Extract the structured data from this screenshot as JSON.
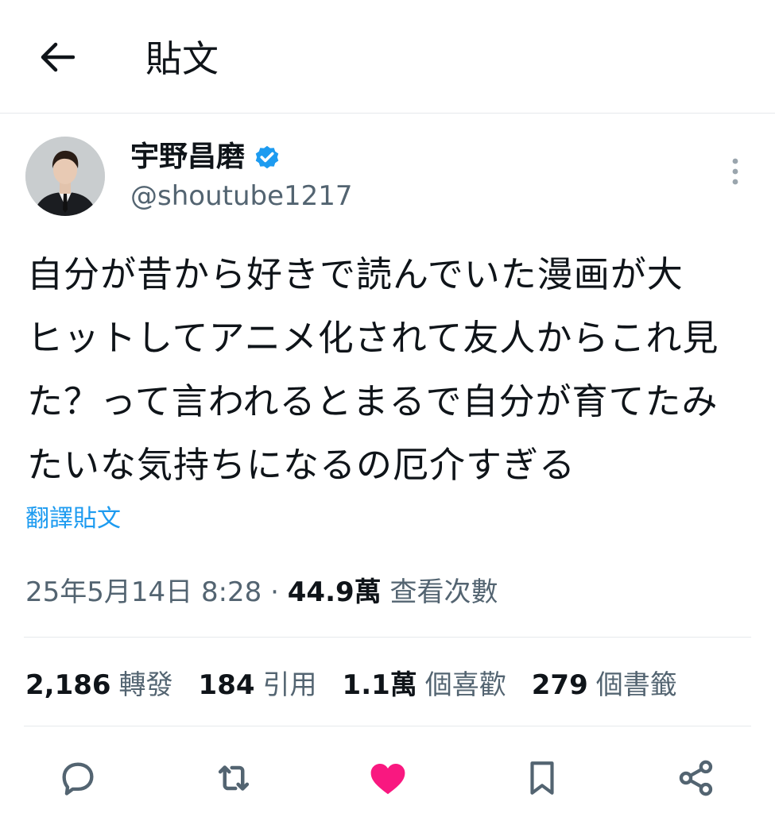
{
  "header": {
    "back_icon": "arrow-left-icon",
    "title": "貼文"
  },
  "author": {
    "display_name": "宇野昌磨",
    "handle": "@shoutube1217",
    "verified_icon": "verified-badge-icon",
    "verified_color": "#1d9bf0"
  },
  "tweet": {
    "lines": [
      "自分が昔から好きで読んでいた漫画が大",
      "ヒットしてアニメ化されて友人からこれ見",
      "た？って言われるとまるで自分が育てたみ",
      "たいな気持ちになるの厄介すぎる"
    ],
    "translate_label": "翻譯貼文",
    "timestamp": "25年5月14日 8:28",
    "separator": "·",
    "views_count": "44.9萬",
    "views_label": "查看次數"
  },
  "stats": {
    "reposts_count": "2,186",
    "reposts_label": "轉發",
    "quotes_count": "184",
    "quotes_label": "引用",
    "likes_count": "1.1萬",
    "likes_label": "個喜歡",
    "bookmarks_count": "279",
    "bookmarks_label": "個書籤"
  },
  "actions": {
    "reply_icon": "reply-icon",
    "repost_icon": "repost-icon",
    "like_icon": "heart-icon",
    "like_color": "#f91880",
    "bookmark_icon": "bookmark-icon",
    "share_icon": "share-icon"
  },
  "colors": {
    "accent": "#1d9bf0",
    "secondary_text": "#536471"
  }
}
